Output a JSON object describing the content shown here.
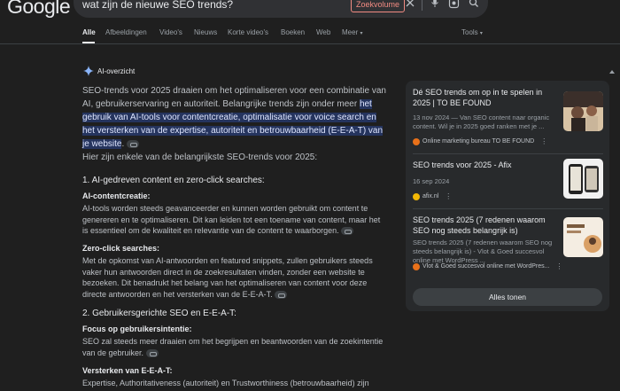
{
  "header": {
    "logo": "Google",
    "search_query": "wat zijn de nieuwe SEO trends?",
    "zoek_button": "Zoekvolume",
    "icons": [
      "close-icon",
      "mic-icon",
      "lens-icon",
      "search-icon"
    ]
  },
  "tabs": [
    {
      "label": "Alle",
      "active": true
    },
    {
      "label": "Afbeeldingen"
    },
    {
      "label": "Video's"
    },
    {
      "label": "Nieuws"
    },
    {
      "label": "Korte video's"
    },
    {
      "label": "Boeken"
    },
    {
      "label": "Web"
    },
    {
      "label": "Meer"
    },
    {
      "label": "Tools"
    }
  ],
  "ai": {
    "label": "AI-overzicht",
    "intro_plain": "SEO-trends voor 2025 draaien om het optimaliseren voor een combinatie van AI, gebruikerservaring en autoriteit. Belangrijke trends zijn onder meer ",
    "intro_highlight": "het gebruik van AI-tools voor contentcreatie, optimalisatie voor voice search en het versterken van de expertise, autoriteit en betrouwbaarheid (E-E-A-T) van je website",
    "intro_end": ".",
    "intro2": "Hier zijn enkele van de belangrijkste SEO-trends voor 2025:",
    "section1": "1. AI-gedreven content en zero-click searches:",
    "s1a_title": "AI-contentcreatie:",
    "s1a_text": "AI-tools worden steeds geavanceerder en kunnen worden gebruikt om content te genereren en te optimaliseren. Dit kan leiden tot een toename van content, maar het is essentieel om de kwaliteit en relevantie van de content te waarborgen.",
    "s1b_title": "Zero-click searches:",
    "s1b_text": "Met de opkomst van AI-antwoorden en featured snippets, zullen gebruikers steeds vaker hun antwoorden direct in de zoekresultaten vinden, zonder een website te bezoeken. Dit benadrukt het belang van het optimaliseren van content voor deze directe antwoorden en het versterken van de E-E-A-T.",
    "section2": "2. Gebruikersgerichte SEO en E-E-A-T:",
    "s2a_title": "Focus op gebruikersintentie:",
    "s2a_text": "SEO zal steeds meer draaien om het begrijpen en beantwoorden van de zoekintentie van de gebruiker.",
    "s2b_title": "Versterken van E-E-A-T:",
    "s2b_text": "Expertise, Authoritativeness (autoriteit) en Trustworthiness (betrouwbaarheid) zijn"
  },
  "sources": [
    {
      "title": "Dé SEO trends om op in te spelen in 2025 | TO BE FOUND",
      "snippet": "13 nov 2024 — Van SEO content naar organic content. Wil je in 2025 goed ranken met je ...",
      "site": "Online marketing bureau TO BE FOUND",
      "favicon_color": "#e8711a"
    },
    {
      "title": "SEO trends voor 2025 - Afix",
      "snippet": "16 sep 2024",
      "site": "afix.nl",
      "favicon_color": "#f2b705"
    },
    {
      "title": "SEO trends 2025 (7 redenen waarom SEO nog steeds belangrijk is)",
      "snippet": "SEO trends 2025 (7 redenen waarom SEO nog steeds belangrijk is) - Vlot & Goed succesvol online met WordPress ...",
      "site": "Vlot & Goed succesvol online met WordPres...",
      "favicon_color": "#e8711a"
    }
  ],
  "alles_tonen": "Alles tonen"
}
